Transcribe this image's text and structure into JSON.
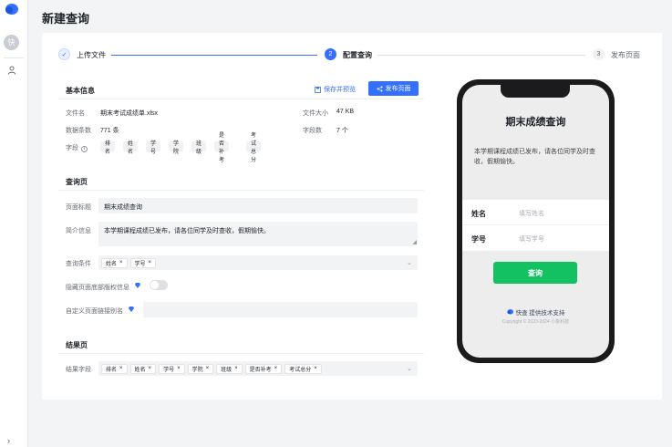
{
  "sidebar": {
    "avatar_text": "快",
    "logo_icon": "logo-icon",
    "user_icon": "user-icon",
    "expand_icon": "chevron-right-icon"
  },
  "page_title": "新建查询",
  "steps": [
    {
      "index": "✓",
      "label": "上传文件",
      "status": "done"
    },
    {
      "index": "2",
      "label": "配置查询",
      "status": "active"
    },
    {
      "index": "3",
      "label": "发布页面",
      "status": "pending"
    }
  ],
  "basic": {
    "title": "基本信息",
    "save_preview": "保存并预览",
    "publish": "发布页面",
    "file_name_label": "文件名",
    "file_name": "期末考试成绩单.xlsx",
    "file_size_label": "文件大小",
    "file_size": "47 KB",
    "rows_label": "数据条数",
    "rows": "771 条",
    "field_count_label": "字段数",
    "field_count": "7 个",
    "fields_label": "字段",
    "fields": [
      "排名",
      "姓名",
      "学号",
      "学院",
      "班级",
      "是否补考",
      "考试总分"
    ]
  },
  "query": {
    "title": "查询页",
    "page_title_label": "页面标题",
    "page_title_value": "期末成绩查询",
    "intro_label": "简介信息",
    "intro_value": "本学期课程成绩已发布，请各位同学及时查收，假期愉快。",
    "conditions_label": "查询条件",
    "conditions": [
      "姓名",
      "学号"
    ],
    "hide_footer_label": "隐藏页面底部版权信息",
    "alias_label": "自定义页面链接别名"
  },
  "result": {
    "title": "结果页",
    "fields_label": "结果字段",
    "fields": [
      "排名",
      "姓名",
      "学号",
      "学院",
      "班级",
      "是否补考",
      "考试总分"
    ]
  },
  "preview": {
    "title": "期末成绩查询",
    "intro": "本学期课程成绩已发布，请各位同学及时查收，假期愉快。",
    "rows": [
      {
        "label": "姓名",
        "placeholder": "填写姓名"
      },
      {
        "label": "学号",
        "placeholder": "填写学号"
      }
    ],
    "button": "查询",
    "support": "快查 提供技术支持",
    "copyright": "Copyright © 2023-2024 小象科技"
  },
  "colors": {
    "primary": "#3370ff",
    "green": "#14c162"
  }
}
